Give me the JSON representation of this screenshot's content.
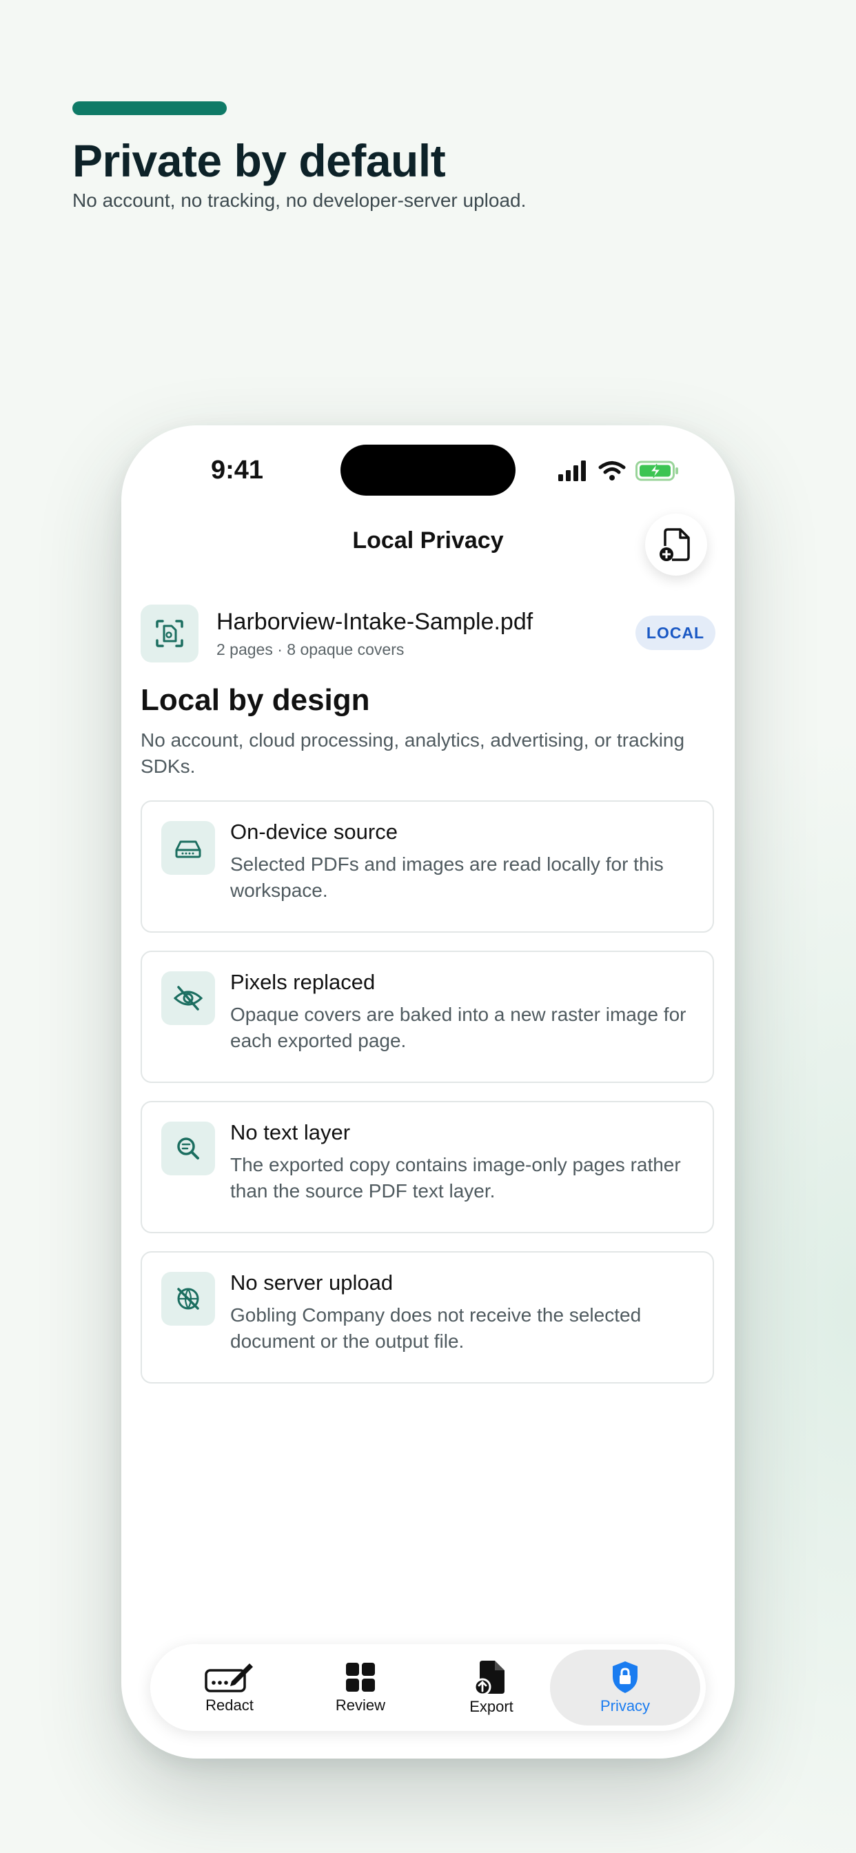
{
  "hero": {
    "title": "Private by default",
    "subtitle": "No account, no tracking, no developer-server upload."
  },
  "status_bar": {
    "time": "9:41"
  },
  "nav": {
    "title": "Local Privacy",
    "add_icon": "doc-plus-icon"
  },
  "document": {
    "name": "Harborview-Intake-Sample.pdf",
    "meta": "2 pages · 8 opaque covers",
    "badge": "LOCAL"
  },
  "section": {
    "title": "Local by design",
    "description": "No account, cloud processing, analytics, advertising, or tracking SDKs."
  },
  "cards": [
    {
      "icon": "drive-icon",
      "title": "On-device source",
      "desc": "Selected PDFs and images are read locally for this workspace."
    },
    {
      "icon": "eye-slash-icon",
      "title": "Pixels replaced",
      "desc": "Opaque covers are baked into a new raster image for each exported page."
    },
    {
      "icon": "magnify-text-icon",
      "title": "No text layer",
      "desc": "The exported copy contains image-only pages rather than the source PDF text layer."
    },
    {
      "icon": "no-network-icon",
      "title": "No server upload",
      "desc": "Gobling Company does not receive the selected document or the output file."
    }
  ],
  "tabs": [
    {
      "label": "Redact",
      "icon": "signature-icon"
    },
    {
      "label": "Review",
      "icon": "grid-icon"
    },
    {
      "label": "Export",
      "icon": "doc-upload-icon"
    },
    {
      "label": "Privacy",
      "icon": "lock-shield-icon",
      "active": true
    }
  ],
  "colors": {
    "accent": "#0e7a66",
    "active_tab": "#1a7cf0",
    "badge_text": "#1a58c4"
  }
}
